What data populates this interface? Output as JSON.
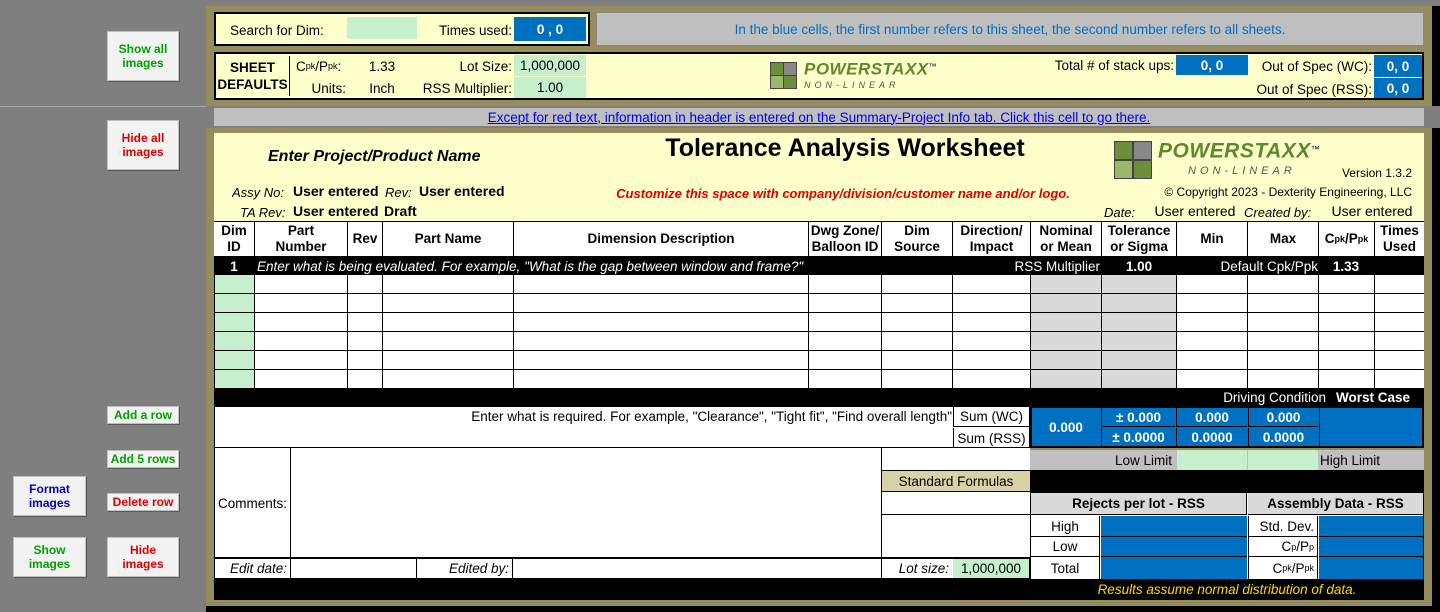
{
  "side_buttons": {
    "show_all": "Show all\nimages",
    "hide_all": "Hide all\nimages",
    "add_row": "Add a row",
    "add5": "Add 5 rows",
    "delete_row": "Delete row",
    "format_images": "Format\nimages",
    "show_images": "Show\nimages",
    "hide_images": "Hide\nimages"
  },
  "search": {
    "label": "Search for Dim:",
    "value": "",
    "times_label": "Times used:",
    "times_value": "0 , 0"
  },
  "blue_note": "In the blue cells, the first number refers to this sheet, the second number refers to all sheets.",
  "defaults": {
    "title": "SHEET\nDEFAULTS",
    "cpk_label": "Cpk/Ppk:",
    "cpk_value": "1.33",
    "units_label": "Units:",
    "units_value": "Inch",
    "lot_label": "Lot Size:",
    "lot_value": "1,000,000",
    "rss_label": "RSS Multiplier:",
    "rss_value": "1.00"
  },
  "logo": {
    "word": "POWERSTAXX",
    "tm": "™",
    "sub": "NON-LINEAR"
  },
  "stack": {
    "total_label": "Total # of stack ups:",
    "total_value": "0, 0",
    "wc_label": "Out of Spec (WC):",
    "wc_value": "0, 0",
    "rss_label": "Out of Spec (RSS):",
    "rss_value": "0, 0"
  },
  "link": "Except for red text, information in header is entered on the Summary-Project Info tab. Click this cell to go there.",
  "header": {
    "project": "Enter Project/Product Name",
    "title": "Tolerance Analysis Worksheet",
    "assy_label": "Assy No:",
    "assy_value": "User entered",
    "rev_label": "Rev:",
    "rev_value": "User entered",
    "ta_label": "TA Rev:",
    "ta_value": "User entered",
    "ta_status": "Draft",
    "customize": "Customize this space with company/division/customer name and/or logo.",
    "version": "Version 1.3.2",
    "copyright": "© Copyright 2023 - Dexterity Engineering, LLC",
    "date_label": "Date:",
    "date_value": "User entered",
    "created_label": "Created by:",
    "created_value": "User entered"
  },
  "columns": [
    "Dim\nID",
    "Part\nNumber",
    "Rev",
    "Part Name",
    "Dimension Description",
    "Dwg Zone/\nBalloon ID",
    "Dim\nSource",
    "Direction/\nImpact",
    "Nominal\nor Mean",
    "Tolerance\nor Sigma",
    "Min",
    "Max",
    "Cpk/Ppk",
    "Times\nUsed"
  ],
  "stack_row": {
    "id": "1",
    "desc": "Enter what is being evaluated. For example, \"What is the gap between window and frame?\"",
    "rss_label": "RSS Multiplier",
    "rss_value": "1.00",
    "cpk_label": "Default Cpk/Ppk",
    "cpk_value": "1.33"
  },
  "driving": {
    "label": "Driving Condition",
    "value": "Worst Case"
  },
  "req": "Enter what is required. For example, \"Clearance\", \"Tight fit\", \"Find overall length\"",
  "sums": {
    "wc_label": "Sum (WC)",
    "rss_label": "Sum (RSS)",
    "nominal": "0.000",
    "tol_wc": "± 0.000",
    "tol_rss": "± 0.0000",
    "min_wc": "0.000",
    "max_wc": "0.000",
    "min_rss": "0.0000",
    "max_rss": "0.0000"
  },
  "limits": {
    "low": "Low Limit",
    "high": "High Limit"
  },
  "comments": {
    "label": "Comments:",
    "std_formulas": "Standard Formulas"
  },
  "rejects": {
    "title": "Rejects per lot - RSS",
    "high": "High",
    "low": "Low",
    "total": "Total"
  },
  "assembly": {
    "title": "Assembly Data - RSS",
    "std": "Std. Dev.",
    "cp": "Cp/Pp",
    "cpk": "Cpk/Ppk"
  },
  "footer": {
    "edit_date": "Edit date:",
    "edited_by": "Edited by:",
    "lot_label": "Lot size:",
    "lot_value": "1,000,000",
    "note": "Results assume normal distribution of data."
  }
}
